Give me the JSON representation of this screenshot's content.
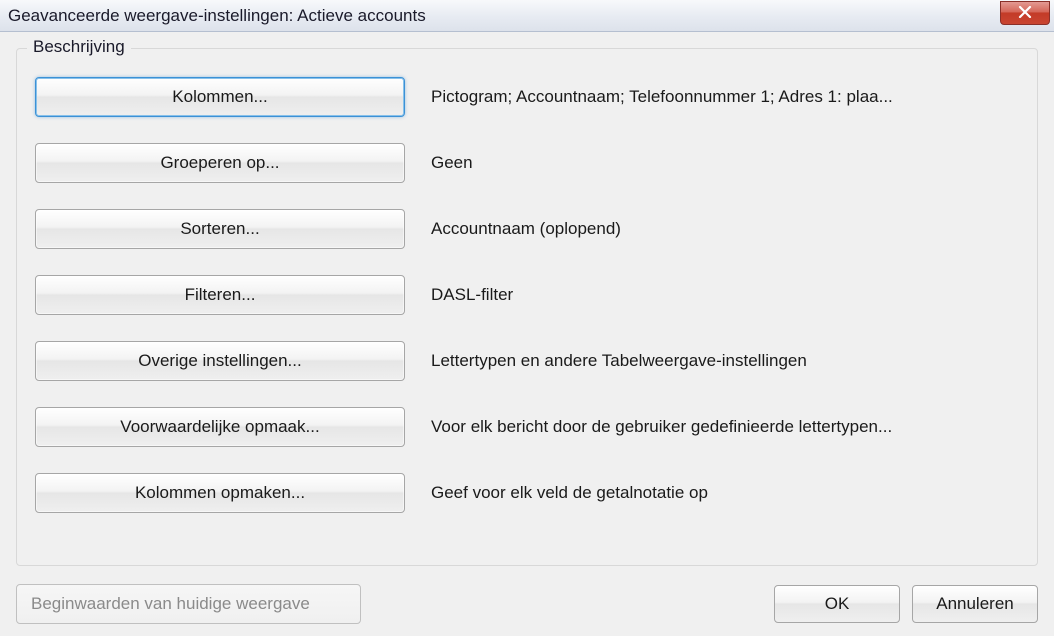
{
  "titlebar": {
    "title": "Geavanceerde weergave-instellingen: Actieve accounts"
  },
  "groupbox": {
    "title": "Beschrijving"
  },
  "rows": [
    {
      "button": "Kolommen...",
      "desc": "Pictogram; Accountnaam; Telefoonnummer 1; Adres 1: plaa..."
    },
    {
      "button": "Groeperen op...",
      "desc": "Geen"
    },
    {
      "button": "Sorteren...",
      "desc": "Accountnaam (oplopend)"
    },
    {
      "button": "Filteren...",
      "desc": "DASL-filter"
    },
    {
      "button": "Overige instellingen...",
      "desc": "Lettertypen en andere Tabelweergave-instellingen"
    },
    {
      "button": "Voorwaardelijke opmaak...",
      "desc": "Voor elk bericht door de gebruiker gedefinieerde lettertypen..."
    },
    {
      "button": "Kolommen opmaken...",
      "desc": "Geef voor elk veld de getalnotatie op"
    }
  ],
  "footer": {
    "reset": "Beginwaarden van huidige weergave",
    "ok": "OK",
    "cancel": "Annuleren"
  }
}
